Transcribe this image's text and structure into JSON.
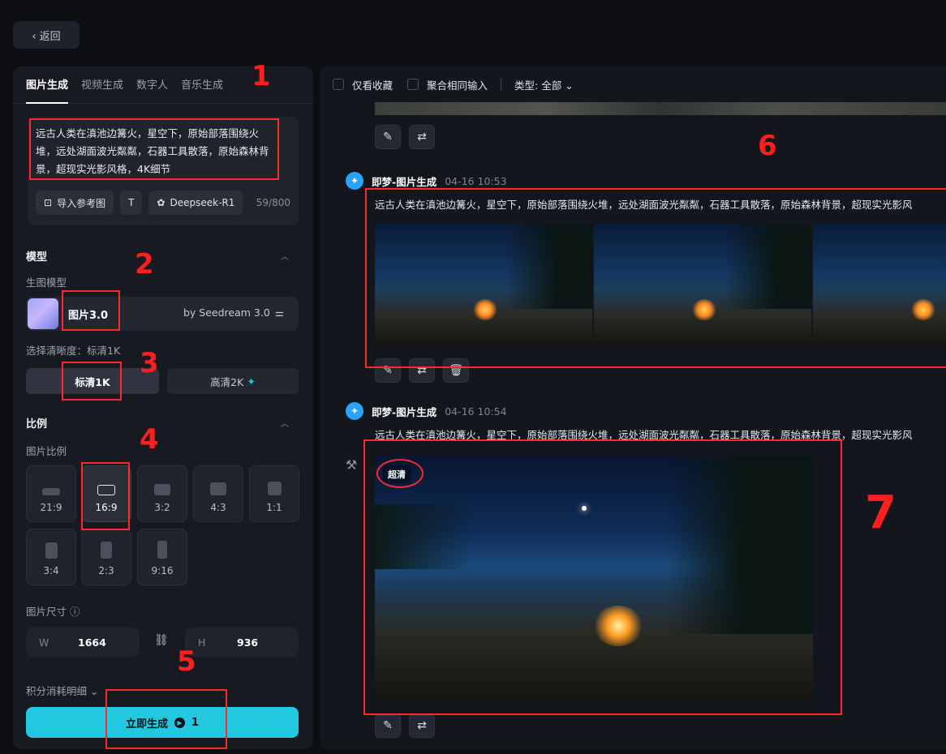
{
  "back": {
    "icon": "chevron-left-icon",
    "label": "‹ 返回"
  },
  "tabs": [
    "图片生成",
    "视频生成",
    "数字人",
    "音乐生成"
  ],
  "prompt": {
    "text": "远古人类在滇池边篝火，星空下，原始部落围绕火堆，远处湖面波光粼粼，石器工具散落，原始森林背景，超现实光影风格，4K细节",
    "import_label": "导入参考图",
    "text_tool_label": "T",
    "model_chip_label": "Deepseek-R1",
    "char_count": "59/800"
  },
  "model_section": {
    "title": "模型",
    "sub": "生图模型",
    "model_name": "图片3.0",
    "model_by": "by Seedream 3.0"
  },
  "resolution": {
    "label": "选择清晰度：标清1K",
    "options": [
      "标清1K",
      "高清2K"
    ],
    "selected": "标清1K"
  },
  "ratio_section": {
    "title": "比例",
    "sub": "图片比例",
    "options": [
      "21:9",
      "16:9",
      "3:2",
      "4:3",
      "1:1",
      "3:4",
      "2:3",
      "9:16"
    ],
    "selected": "16:9"
  },
  "size": {
    "label": "图片尺寸 ⓘ",
    "w_label": "W",
    "w_value": "1664",
    "h_label": "H",
    "h_value": "936"
  },
  "credits_label": "积分消耗明细 ⌄",
  "generate": {
    "label": "立即生成",
    "cost": "1"
  },
  "filter": {
    "favorites": "仅看收藏",
    "merge": "聚合相同输入",
    "type": "类型: 全部 ⌄"
  },
  "generations": [
    {
      "name": "即梦-图片生成",
      "time": "04-16  10:53",
      "prompt": "远古人类在滇池边篝火，星空下，原始部落围绕火堆，远处湖面波光粼粼，石器工具散落，原始森林背景，超现实光影风"
    },
    {
      "name": "即梦-图片生成",
      "time": "04-16  10:54",
      "prompt": "远古人类在滇池边篝火，星空下，原始部落围绕火堆，远处湖面波光粼粼，石器工具散落，原始森林背景，超现实光影风",
      "badge": "超清"
    }
  ],
  "annotations": [
    "1",
    "2",
    "3",
    "4",
    "5",
    "6",
    "7"
  ],
  "colors": {
    "accent": "#22c7e0",
    "annotation": "#ff2a2a",
    "panel": "#171a21",
    "background": "#0d0f13"
  }
}
